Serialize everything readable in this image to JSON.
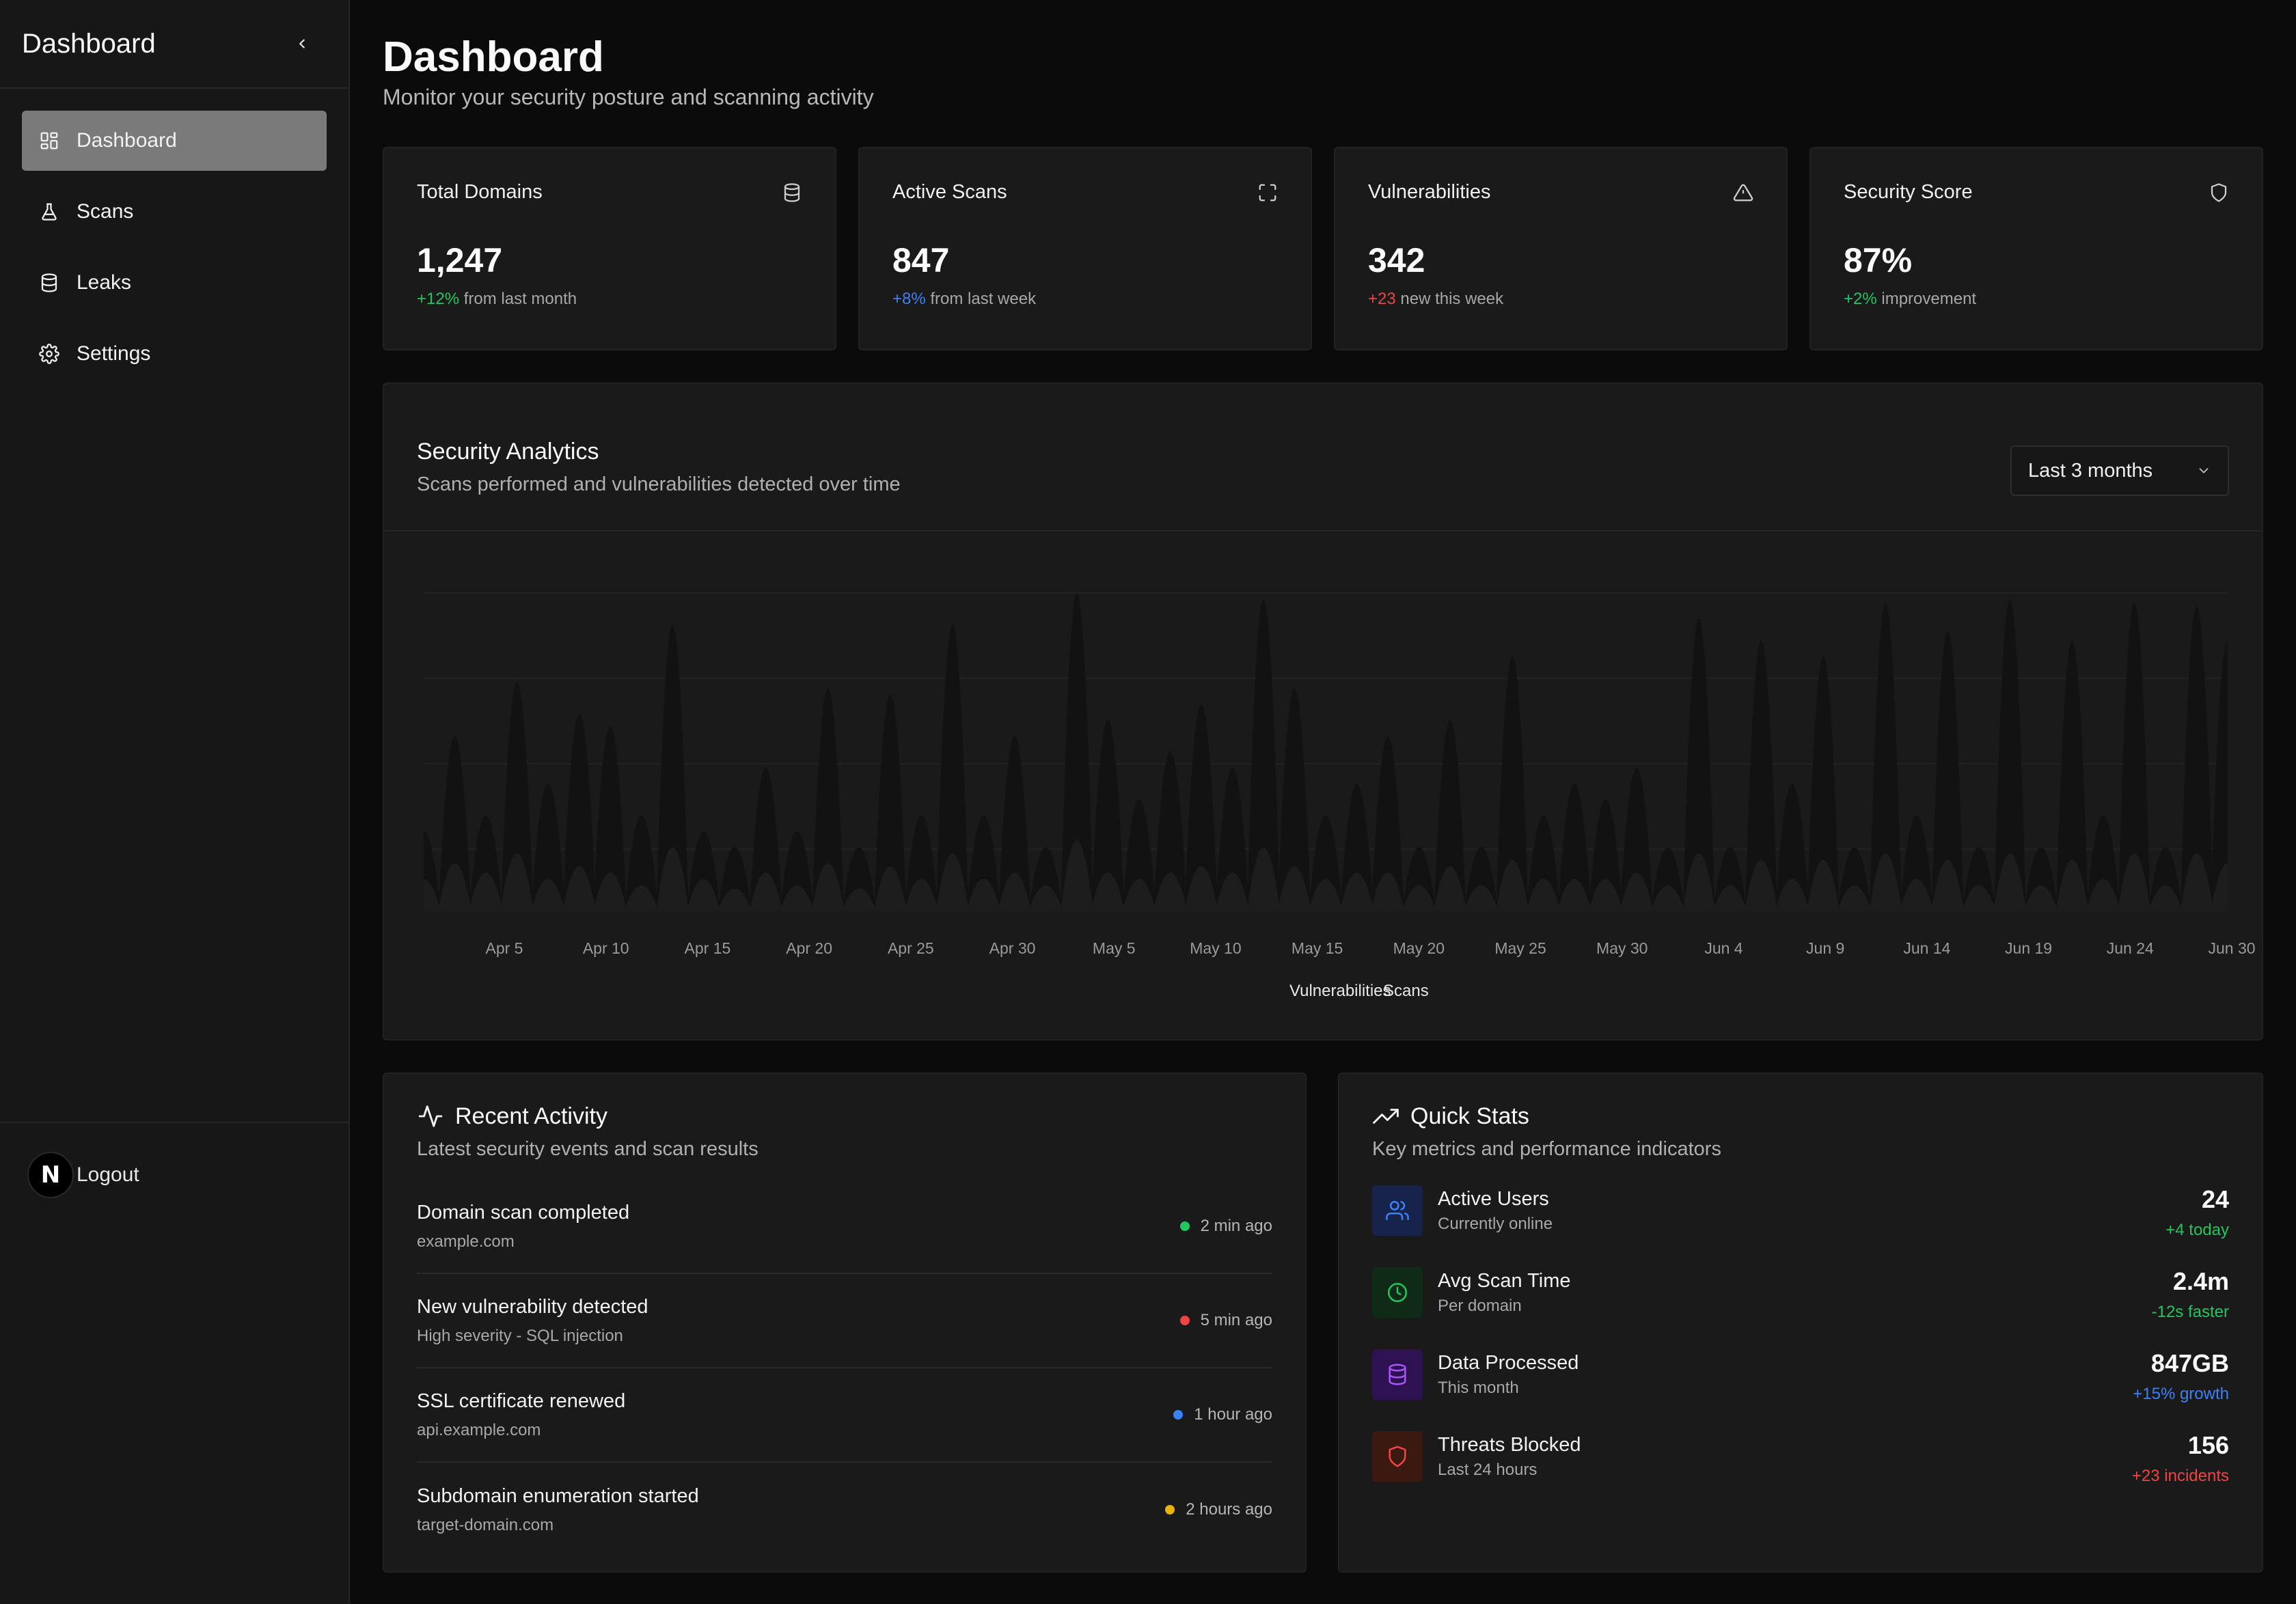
{
  "sidebar": {
    "title": "Dashboard",
    "items": [
      {
        "label": "Dashboard",
        "icon": "layout-dashboard-icon",
        "active": true
      },
      {
        "label": "Scans",
        "icon": "flask-icon",
        "active": false
      },
      {
        "label": "Leaks",
        "icon": "database-icon",
        "active": false
      },
      {
        "label": "Settings",
        "icon": "gear-icon",
        "active": false
      }
    ],
    "logout": {
      "avatar_letter": "N",
      "label": "Logout"
    }
  },
  "header": {
    "title": "Dashboard",
    "subtitle": "Monitor your security posture and scanning activity"
  },
  "stats": [
    {
      "label": "Total Domains",
      "icon": "database-icon",
      "value": "1,247",
      "delta": "+12%",
      "delta_color": "#22c55e",
      "note": " from last month"
    },
    {
      "label": "Active Scans",
      "icon": "scan-frame-icon",
      "value": "847",
      "delta": "+8%",
      "delta_color": "#3b82f6",
      "note": " from last week"
    },
    {
      "label": "Vulnerabilities",
      "icon": "alert-triangle-icon",
      "value": "342",
      "delta": "+23",
      "delta_color": "#ef4444",
      "note": " new this week"
    },
    {
      "label": "Security Score",
      "icon": "shield-icon",
      "value": "87%",
      "delta": "+2%",
      "delta_color": "#22c55e",
      "note": " improvement"
    }
  ],
  "analytics": {
    "title": "Security Analytics",
    "subtitle": "Scans performed and vulnerabilities detected over time",
    "range_select": {
      "value": "Last 3 months"
    },
    "legend": [
      "Vulnerabilities",
      "Scans"
    ]
  },
  "chart_data": {
    "type": "area",
    "x_tick_labels": [
      "Apr 5",
      "Apr 10",
      "Apr 15",
      "Apr 20",
      "Apr 25",
      "Apr 30",
      "May 5",
      "May 10",
      "May 15",
      "May 20",
      "May 25",
      "May 30",
      "Jun 4",
      "Jun 9",
      "Jun 14",
      "Jun 19",
      "Jun 24",
      "Jun 30"
    ],
    "series": [
      {
        "name": "Scans",
        "color": "#121212",
        "peaks": [
          0.25,
          0.55,
          0.3,
          0.72,
          0.4,
          0.62,
          0.58,
          0.3,
          0.9,
          0.25,
          0.2,
          0.45,
          0.25,
          0.7,
          0.2,
          0.68,
          0.3,
          0.9,
          0.3,
          0.55,
          0.2,
          1.0,
          0.6,
          0.35,
          0.5,
          0.65,
          0.45,
          0.98,
          0.7,
          0.3,
          0.4,
          0.55,
          0.2,
          0.6,
          0.2,
          0.8,
          0.3,
          0.4,
          0.35,
          0.45,
          0.2,
          0.92,
          0.2,
          0.85,
          0.4,
          0.8,
          0.2,
          0.97,
          0.3,
          0.88,
          0.2,
          0.98,
          0.2,
          0.85,
          0.3,
          0.97,
          0.2,
          0.96,
          0.85
        ]
      },
      {
        "name": "Vulnerabilities",
        "color": "#1d1d1d",
        "peaks": [
          0.1,
          0.15,
          0.12,
          0.18,
          0.1,
          0.14,
          0.12,
          0.08,
          0.2,
          0.1,
          0.07,
          0.12,
          0.08,
          0.15,
          0.07,
          0.14,
          0.1,
          0.18,
          0.1,
          0.12,
          0.08,
          0.22,
          0.12,
          0.1,
          0.12,
          0.14,
          0.12,
          0.2,
          0.14,
          0.1,
          0.12,
          0.12,
          0.08,
          0.14,
          0.08,
          0.16,
          0.1,
          0.1,
          0.1,
          0.12,
          0.08,
          0.18,
          0.08,
          0.16,
          0.1,
          0.16,
          0.08,
          0.18,
          0.1,
          0.16,
          0.08,
          0.18,
          0.08,
          0.16,
          0.1,
          0.18,
          0.08,
          0.18,
          0.15
        ]
      }
    ],
    "grid": "horizontal",
    "legend_position": "bottom-center"
  },
  "activity": {
    "title": "Recent Activity",
    "subtitle": "Latest security events and scan results",
    "items": [
      {
        "title": "Domain scan completed",
        "sub": "example.com",
        "time": "2 min ago",
        "dot": "#22c55e"
      },
      {
        "title": "New vulnerability detected",
        "sub": "High severity - SQL injection",
        "time": "5 min ago",
        "dot": "#ef4444"
      },
      {
        "title": "SSL certificate renewed",
        "sub": "api.example.com",
        "time": "1 hour ago",
        "dot": "#3b82f6"
      },
      {
        "title": "Subdomain enumeration started",
        "sub": "target-domain.com",
        "time": "2 hours ago",
        "dot": "#eab308"
      }
    ]
  },
  "quick": {
    "title": "Quick Stats",
    "subtitle": "Key metrics and performance indicators",
    "items": [
      {
        "title": "Active Users",
        "sub": "Currently online",
        "value": "24",
        "delta": "+4 today",
        "icon": "users-icon",
        "color": "#3b82f6",
        "bg": "#17234a"
      },
      {
        "title": "Avg Scan Time",
        "sub": "Per domain",
        "value": "2.4m",
        "delta": "-12s faster",
        "icon": "clock-icon",
        "color": "#22c55e",
        "bg": "#0f2a17"
      },
      {
        "title": "Data Processed",
        "sub": "This month",
        "value": "847GB",
        "delta": "+15% growth",
        "icon": "database-icon",
        "color": "#a855f7",
        "bg": "#2e1150"
      },
      {
        "title": "Threats Blocked",
        "sub": "Last 24 hours",
        "value": "156",
        "delta": "+23 incidents",
        "icon": "shield-icon",
        "color": "#ef4444",
        "bg": "#3a1a10"
      }
    ]
  }
}
